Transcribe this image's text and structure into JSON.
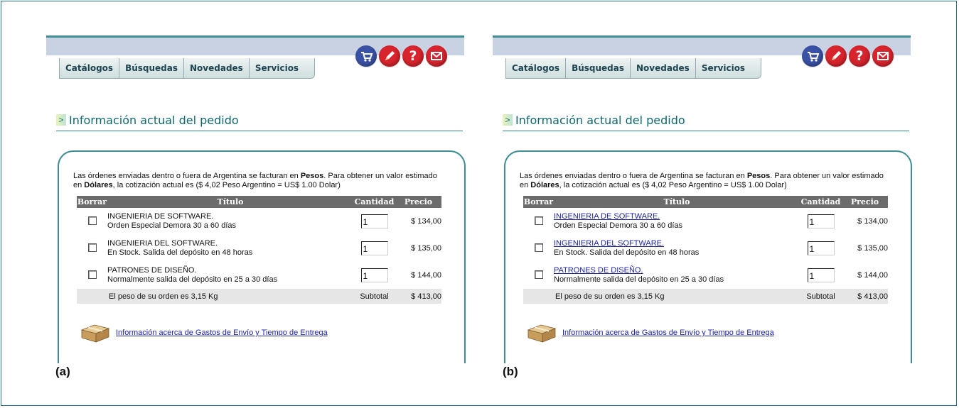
{
  "tabs": [
    "Catálogos",
    "Búsquedas",
    "Novedades",
    "Servicios"
  ],
  "icons": [
    "cart-icon",
    "pencil-icon",
    "help-icon",
    "mail-icon"
  ],
  "help_glyph": "?",
  "section_title": "Información actual del pedido",
  "notice": {
    "part1": "Las órdenes enviadas dentro o fuera de Argentina se facturan en ",
    "bold1": "Pesos",
    "part2": ". Para obtener un valor estimado en ",
    "bold2": "Dólares",
    "part3": ", la cotización actual es ($ 4,02 Peso Argentino = US$ 1.00 Dolar)"
  },
  "table": {
    "headers": [
      "Borrar",
      "Título",
      "Cantidad",
      "Precio"
    ],
    "rows": [
      {
        "title": "INGENIERIA DE SOFTWARE.",
        "status": "Orden Especial Demora 30 a 60 días",
        "qty": "1",
        "price": "$ 134,00"
      },
      {
        "title": "INGENIERIA DEL SOFTWARE.",
        "status": "En Stock. Salida del depósito en 48 horas",
        "qty": "1",
        "price": "$ 135,00"
      },
      {
        "title": "PATRONES DE DISEÑO.",
        "status": "Normalmente salida del depósito en 25 a 30 días",
        "qty": "1",
        "price": "$ 144,00"
      }
    ],
    "weight_text": "El peso de su orden es 3,15 Kg",
    "subtotal_label": "Subtotal",
    "subtotal_value": "$ 413,00"
  },
  "shipping_link": "Información acerca de Gastos de Envío y Tiempo de Entrega",
  "labels": {
    "a": "(a)",
    "b": "(b)"
  },
  "colors": {
    "accent": "#3d8d94",
    "tab_text": "#1d4450",
    "link": "#1d25a0",
    "header_bg": "#6b6b6b",
    "icon_red": "#d8242c",
    "icon_blue": "#3a52a5"
  }
}
